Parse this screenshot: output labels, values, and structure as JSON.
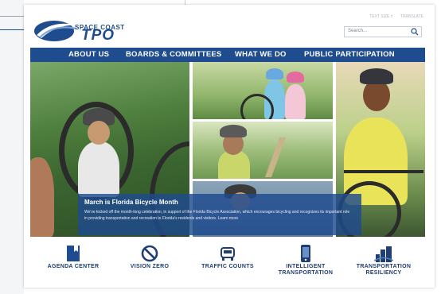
{
  "logo": {
    "line1": "SPACE COAST",
    "line2": "TPO"
  },
  "top_links": [
    "TEXT SIZE ±",
    "TRANSLATE"
  ],
  "search": {
    "placeholder": "Search..."
  },
  "nav": {
    "items": [
      "ABOUT US",
      "BOARDS & COMMITTEES",
      "WHAT WE DO",
      "PUBLIC PARTICIPATION"
    ]
  },
  "hero": {
    "title": "March is Florida Bicycle Month",
    "body": "We've kicked off the month-long celebration, in support of the Florida Bicycle Association, which encourages bicycling and recognizes its important role in providing transportation and recreation to Florida's residents and visitors. Learn more"
  },
  "carousel": {
    "slides": 2,
    "active": 1
  },
  "quick_links": [
    {
      "label": "AGENDA CENTER",
      "icon": "document-icon"
    },
    {
      "label": "VISION ZERO",
      "icon": "no-entry-icon"
    },
    {
      "label": "TRAFFIC COUNTS",
      "icon": "car-icon"
    },
    {
      "label": "INTELLIGENT TRANSPORTATION",
      "icon": "phone-icon"
    },
    {
      "label": "TRANSPORTATION RESILIENCY",
      "icon": "skyline-icon"
    }
  ],
  "colors": {
    "brand": "#1f4b8f",
    "text_dark": "#1f3e73"
  }
}
